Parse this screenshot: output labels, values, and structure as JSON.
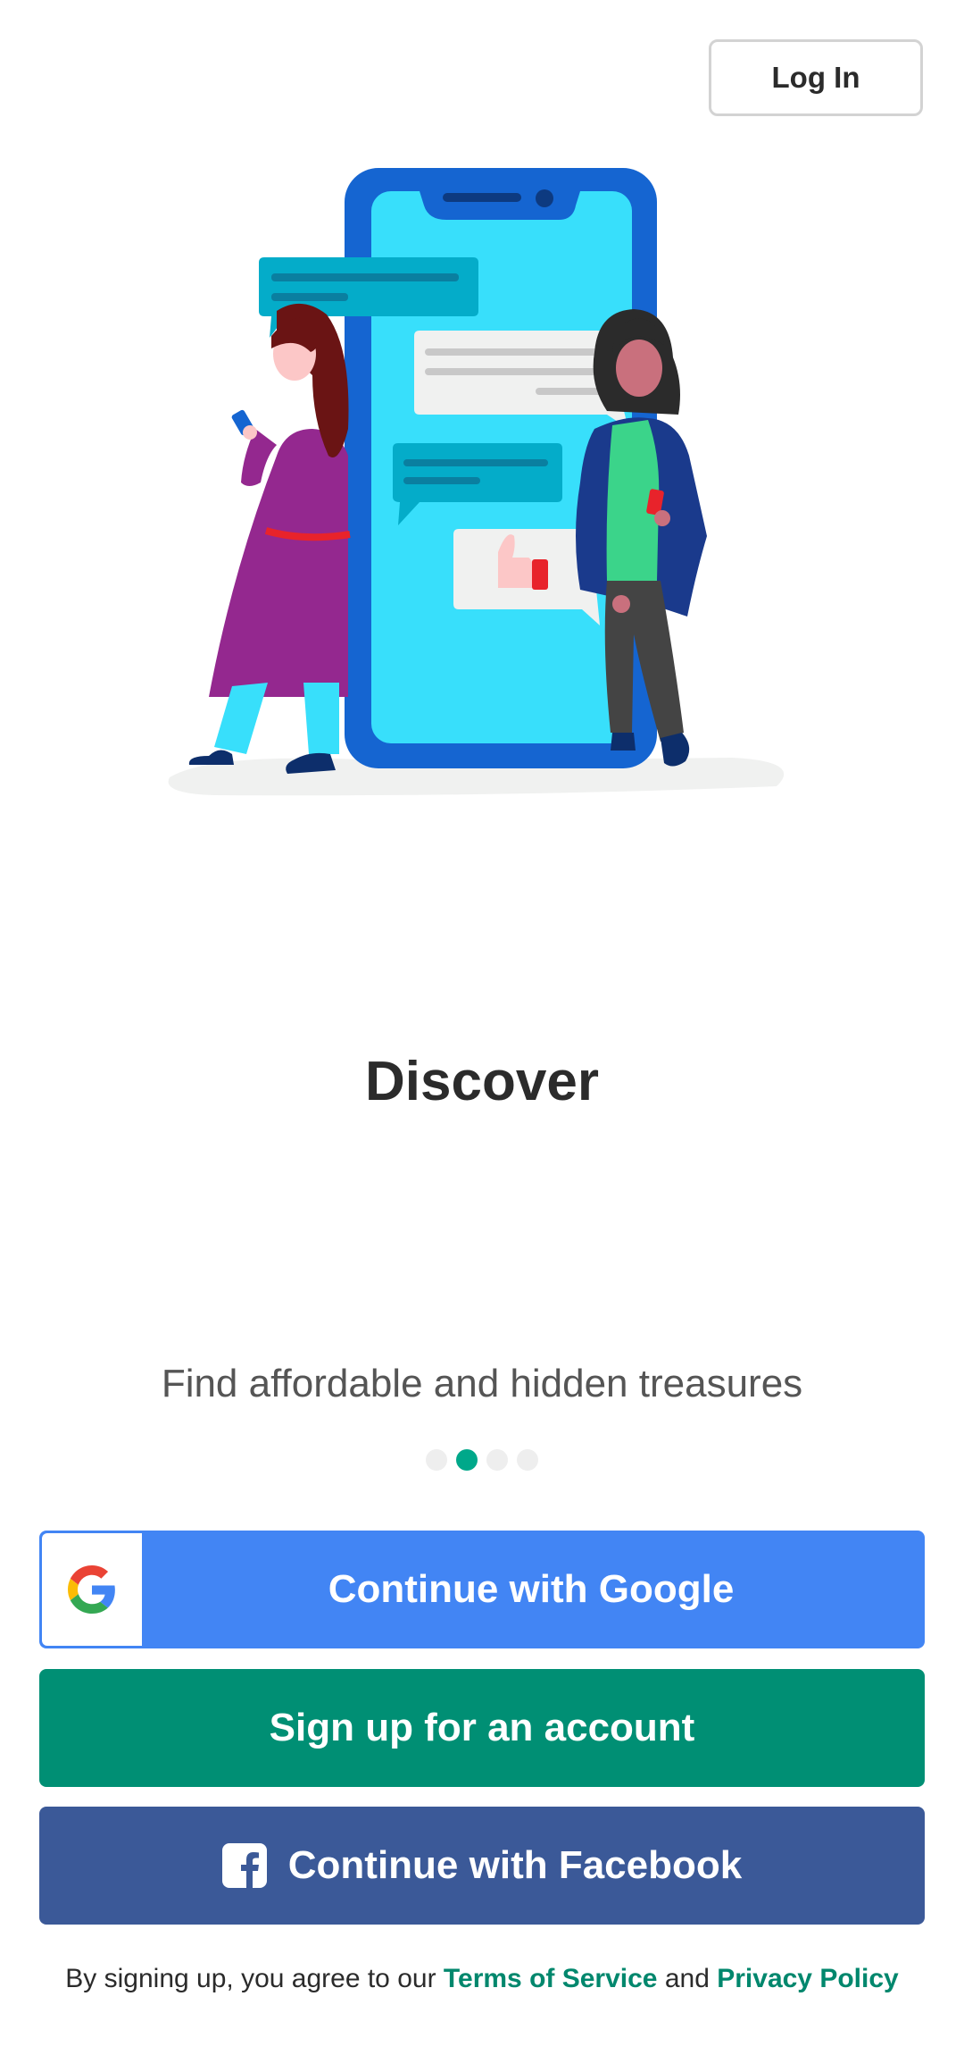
{
  "header": {
    "login_label": "Log In"
  },
  "onboarding": {
    "title": "Discover",
    "subtitle": "Find affordable and hidden treasures",
    "page_count": 4,
    "active_page": 2
  },
  "actions": {
    "google_label": "Continue with Google",
    "signup_label": "Sign up for an account",
    "facebook_label": "Continue with Facebook"
  },
  "legal": {
    "prefix": "By signing up, you agree to our",
    "terms_label": "Terms of Service",
    "conjunction": "and",
    "privacy_label": "Privacy Policy"
  },
  "colors": {
    "google_blue": "#4285f4",
    "brand_green": "#008f74",
    "facebook_blue": "#3b5998",
    "dot_active": "#00a88a",
    "dot_inactive": "#eeeeee"
  },
  "icons": {
    "google": "google-g-icon",
    "facebook": "facebook-f-icon"
  }
}
